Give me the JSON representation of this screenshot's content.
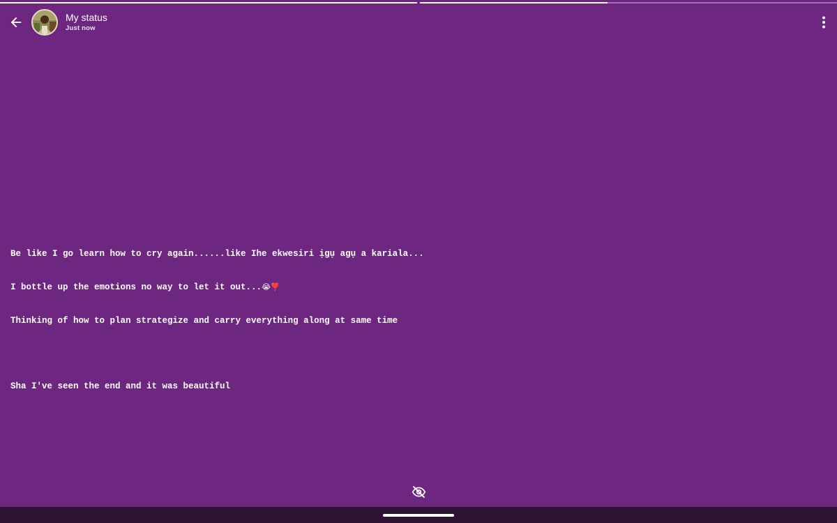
{
  "header": {
    "title": "My status",
    "timestamp": "Just now"
  },
  "progress": {
    "segments": [
      {
        "fill_fraction": 1.0
      },
      {
        "fill_fraction": 0.45
      }
    ]
  },
  "status": {
    "background_color": "#6e2780",
    "text_color": "#ffffff",
    "lines": [
      "Be like I go learn how to cry again......like Ihe ekwesiri ịgụ agụ a kariala...",
      "I bottle up the emotions no way to let it out...",
      "Thinking of how to plan strategize and carry everything along at same time",
      "Sha I've seen the end and it was beautiful"
    ],
    "line2_emojis": "😭❣️"
  },
  "icons": {
    "back": "arrow-left-icon",
    "menu": "more-vertical-icon",
    "viewers": "eye-off-icon"
  }
}
